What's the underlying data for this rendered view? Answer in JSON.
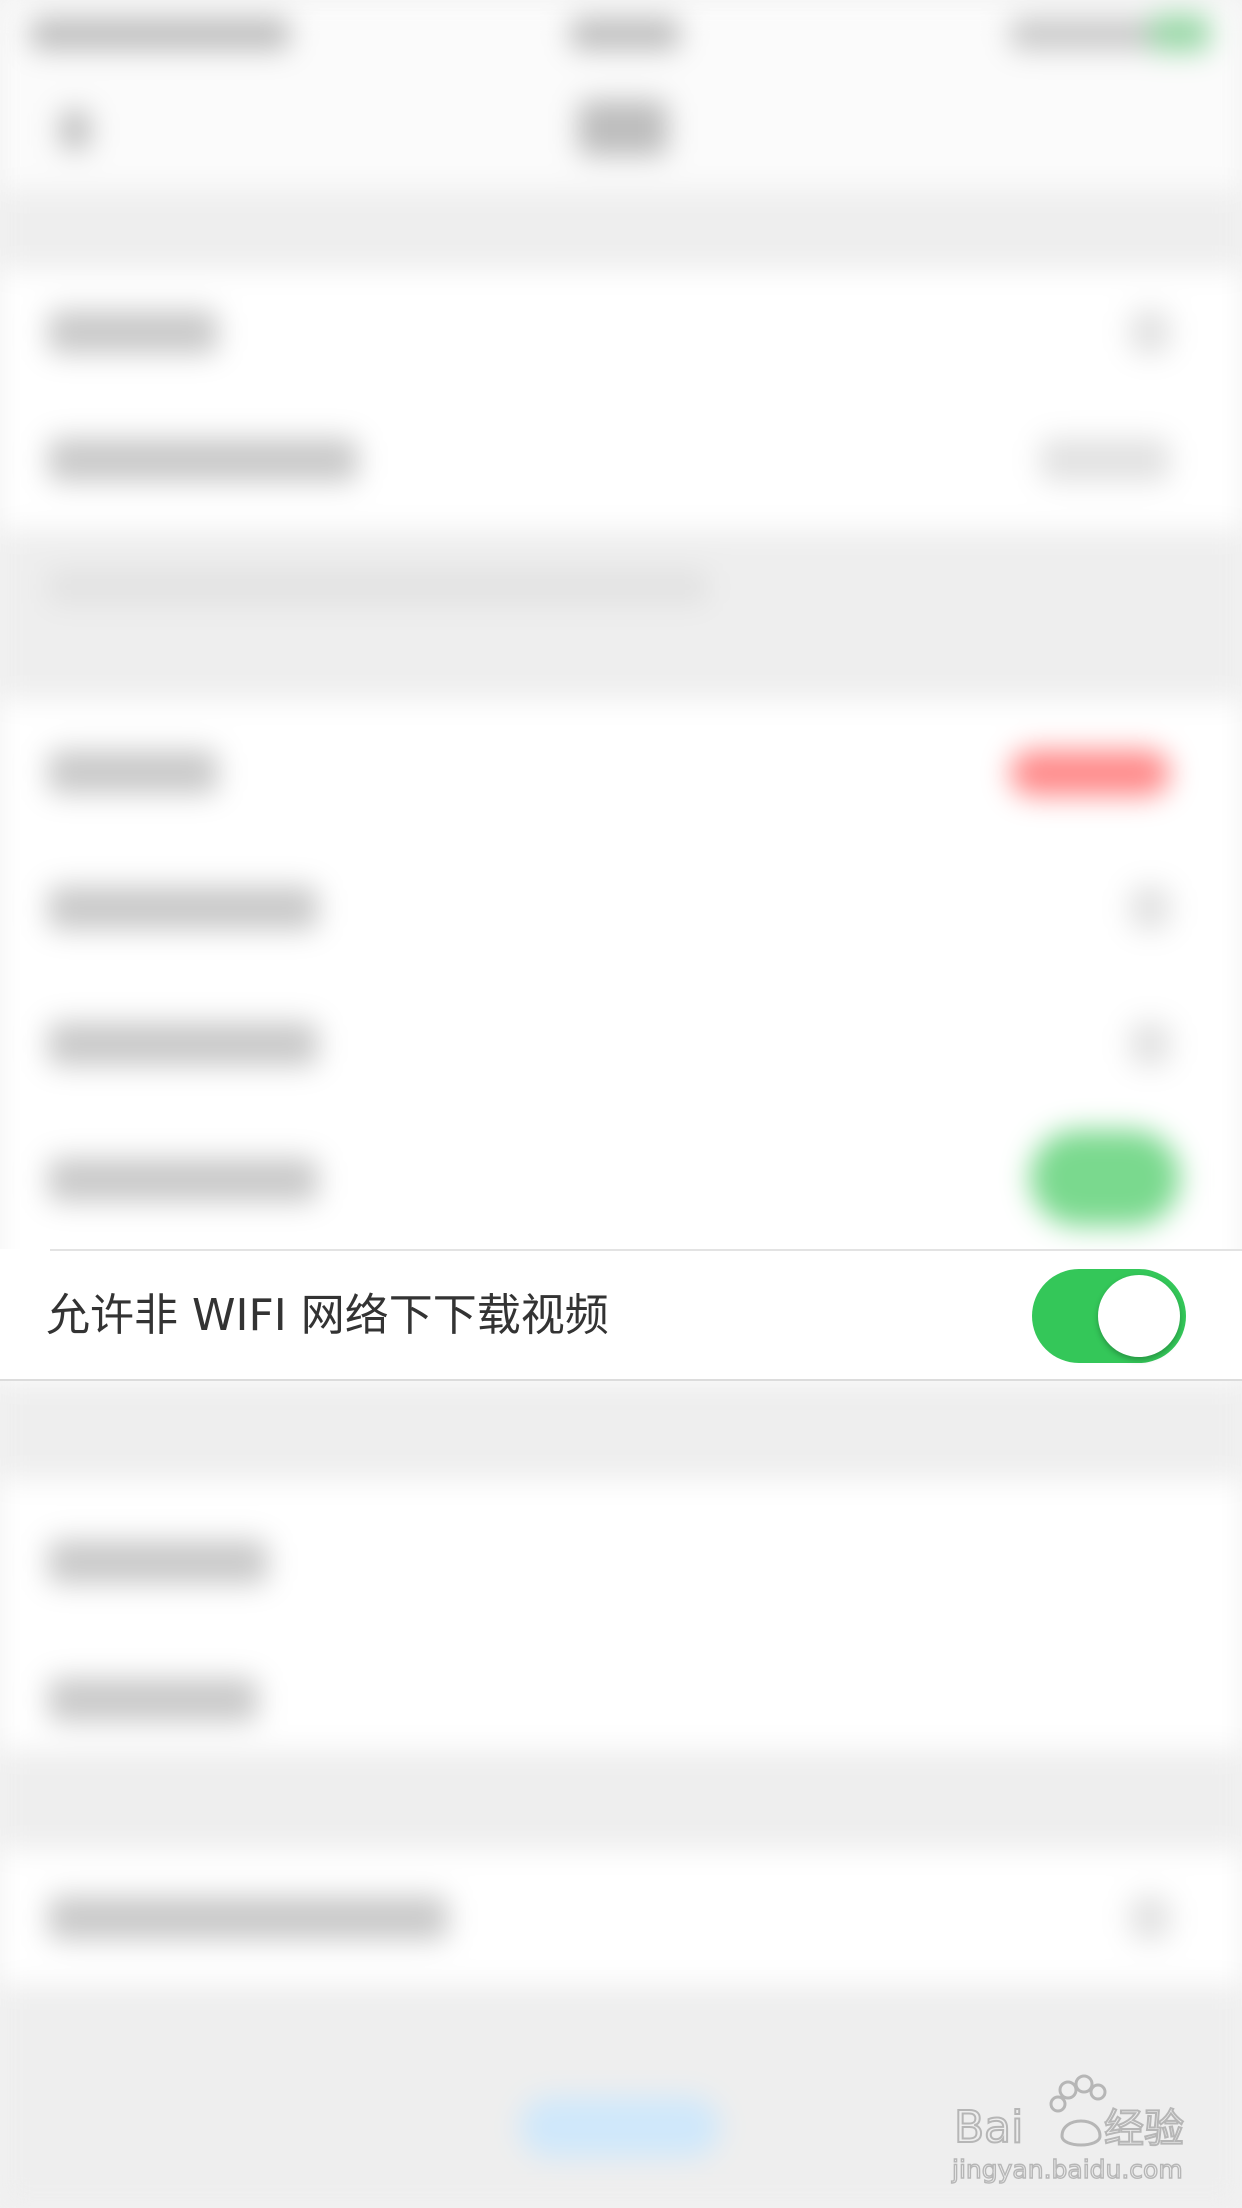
{
  "setting_row": {
    "label": "允许非 WIFI 网络下下载视频",
    "toggle_on": true
  },
  "colors": {
    "toggle_on": "#34c759",
    "background": "#f2f2f2",
    "row_background": "#ffffff",
    "label_text": "#333333"
  },
  "watermark": {
    "brand": "Baidu经验",
    "url": "jingyan.baidu.com"
  }
}
